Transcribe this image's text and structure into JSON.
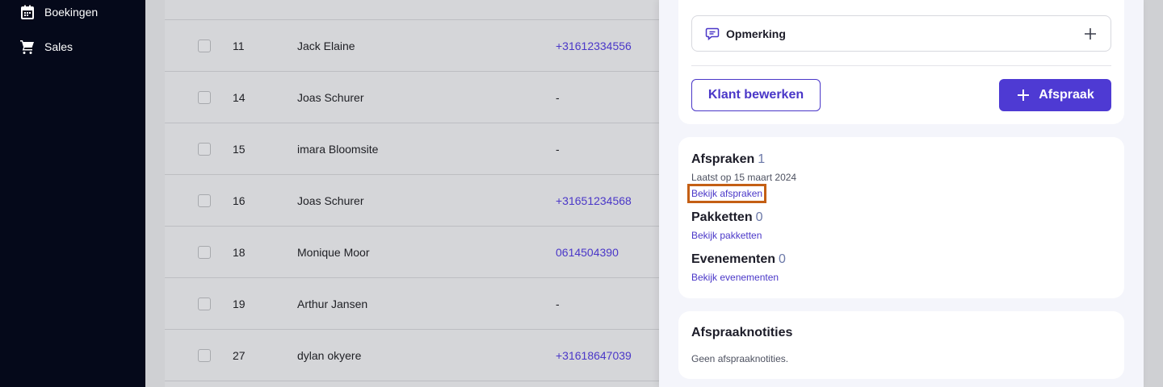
{
  "sidebar": {
    "items": [
      {
        "label": "Boekingen",
        "icon": "calendar-icon"
      },
      {
        "label": "Sales",
        "icon": "cart-icon"
      }
    ]
  },
  "table": {
    "rows": [
      {
        "id": "11",
        "name": "Jack Elaine",
        "phone": "+31612334556"
      },
      {
        "id": "14",
        "name": "Joas Schurer",
        "phone": "-"
      },
      {
        "id": "15",
        "name": "imara Bloomsite",
        "phone": "-"
      },
      {
        "id": "16",
        "name": "Joas Schurer",
        "phone": "+31651234568"
      },
      {
        "id": "18",
        "name": "Monique Moor",
        "phone": "0614504390"
      },
      {
        "id": "19",
        "name": "Arthur Jansen",
        "phone": "-"
      },
      {
        "id": "27",
        "name": "dylan okyere",
        "phone": "+31618647039"
      }
    ]
  },
  "drawer": {
    "remark_label": "Opmerking",
    "edit_button": "Klant bewerken",
    "add_button": "Afspraak",
    "appointments": {
      "title": "Afspraken",
      "count": "1",
      "last": "Laatst op 15 maart 2024",
      "link": "Bekijk afspraken"
    },
    "packages": {
      "title": "Pakketten",
      "count": "0",
      "link": "Bekijk pakketten"
    },
    "events": {
      "title": "Evenementen",
      "count": "0",
      "link": "Bekijk evenementen"
    },
    "notes": {
      "title": "Afspraaknotities",
      "empty": "Geen afspraaknotities."
    }
  },
  "colors": {
    "accent": "#4e3ad3",
    "sidebar": "#05091a",
    "highlight": "#c45f14"
  }
}
